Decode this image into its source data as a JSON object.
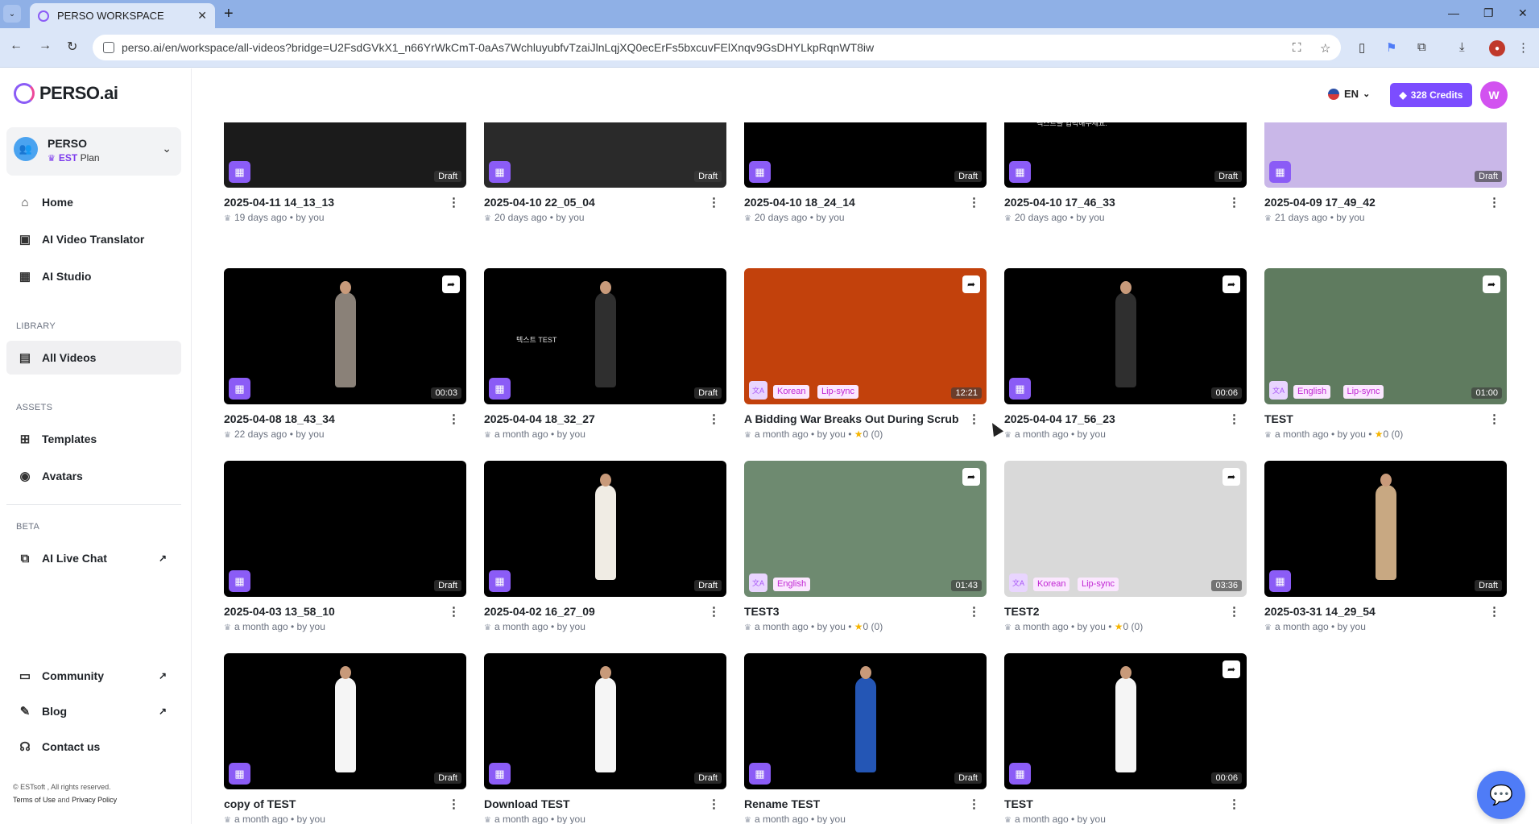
{
  "browser": {
    "tab_title": "PERSO WORKSPACE",
    "url": "perso.ai/en/workspace/all-videos?bridge=U2FsdGVkX1_n66YrWkCmT-0aAs7WchluyubfvTzaiJlnLqjXQ0ecErFs5bxcuvFElXnqv9GsDHYLkpRqnWT8iw",
    "icons": [
      "chevron-down-icon",
      "close-icon",
      "plus-icon",
      "minimize-icon",
      "restore-icon",
      "window-close-icon",
      "back-icon",
      "forward-icon",
      "reload-icon",
      "site-info-icon",
      "translate-icon",
      "star-icon",
      "sidepanel-icon",
      "extension-icon",
      "puzzle-icon",
      "download-icon",
      "profile-icon",
      "more-icon"
    ]
  },
  "sidebar": {
    "logo": "PERSO.ai",
    "workspace": {
      "name": "PERSO",
      "plan_em": "EST",
      "plan": "Plan"
    },
    "main_nav": [
      {
        "label": "Home",
        "icon": "home-icon"
      },
      {
        "label": "AI Video Translator",
        "icon": "translator-icon"
      },
      {
        "label": "AI Studio",
        "icon": "studio-icon"
      }
    ],
    "library_label": "LIBRARY",
    "library": [
      {
        "label": "All Videos",
        "icon": "folder-icon"
      }
    ],
    "assets_label": "ASSETS",
    "assets": [
      {
        "label": "Templates",
        "icon": "template-icon"
      },
      {
        "label": "Avatars",
        "icon": "avatar-icon"
      }
    ],
    "beta_label": "BETA",
    "beta": [
      {
        "label": "AI Live Chat",
        "icon": "chat-icon"
      }
    ],
    "bottom": [
      {
        "label": "Community",
        "icon": "community-icon"
      },
      {
        "label": "Blog",
        "icon": "blog-icon"
      },
      {
        "label": "Contact us",
        "icon": "headset-icon"
      }
    ],
    "footer": {
      "copyright": "© ESTsoft , All rights reserved.",
      "terms": "Terms of Use",
      "and": "and",
      "privacy": "Privacy Policy"
    }
  },
  "header": {
    "lang": "EN",
    "credits": "328 Credits",
    "user_initial": "W"
  },
  "videos": [
    {
      "title": "2025-04-11 14_13_13",
      "meta": "19 days ago • by you",
      "status": "Draft",
      "kind": "studio",
      "bg": "#1b1b1b"
    },
    {
      "title": "2025-04-10 22_05_04",
      "meta": "20 days ago • by you",
      "status": "Draft",
      "kind": "studio",
      "bg": "#2a2a2a"
    },
    {
      "title": "2025-04-10 18_24_14",
      "meta": "20 days ago • by you",
      "status": "Draft",
      "kind": "studio",
      "bg": "#000000"
    },
    {
      "title": "2025-04-10 17_46_33",
      "meta": "20 days ago • by you",
      "status": "Draft",
      "kind": "studio",
      "bg": "#000000",
      "thumb_text": "텍스트를 입력해주세요."
    },
    {
      "title": "2025-04-09 17_49_42",
      "meta": "21 days ago • by you",
      "status": "Draft",
      "kind": "studio",
      "bg": "#c9b7e8"
    },
    {
      "title": "2025-04-08 18_43_34",
      "meta": "22 days ago • by you",
      "status": "00:03",
      "kind": "studio",
      "share": true,
      "bg": "#000000",
      "figure": "#8a8178"
    },
    {
      "title": "2025-04-04 18_32_27",
      "meta": "a month ago • by you",
      "status": "Draft",
      "kind": "studio",
      "bg": "#000000",
      "figure": "#2f2f2f",
      "thumb_text": "텍스트 TEST"
    },
    {
      "title": "A Bidding War Breaks Out During Scrub ...",
      "meta": "a month ago • by you •",
      "rating": "0 (0)",
      "status": "12:21",
      "kind": "translate",
      "tags": [
        "Korean",
        "Lip-sync"
      ],
      "share": true,
      "bg": "#c2410c"
    },
    {
      "title": "2025-04-04 17_56_23",
      "meta": "a month ago • by you",
      "status": "00:06",
      "kind": "studio",
      "share": true,
      "bg": "#000000",
      "figure": "#2f2f2f"
    },
    {
      "title": "TEST",
      "meta": "a month ago • by you •",
      "rating": "0 (0)",
      "status": "01:00",
      "kind": "translate",
      "tags": [
        "English",
        "Lip-sync"
      ],
      "share": true,
      "bg": "#5f7b5f"
    },
    {
      "title": "2025-04-03 13_58_10",
      "meta": "a month ago • by you",
      "status": "Draft",
      "kind": "studio",
      "bg": "#000000"
    },
    {
      "title": "2025-04-02 16_27_09",
      "meta": "a month ago • by you",
      "status": "Draft",
      "kind": "studio",
      "bg": "#000000",
      "figure": "#f0ece4"
    },
    {
      "title": "TEST3",
      "meta": "a month ago • by you •",
      "rating": "0 (0)",
      "status": "01:43",
      "kind": "translate",
      "tags": [
        "English"
      ],
      "share": true,
      "bg": "#6e8a70"
    },
    {
      "title": "TEST2",
      "meta": "a month ago • by you •",
      "rating": "0 (0)",
      "status": "03:36",
      "kind": "translate",
      "tags": [
        "Korean",
        "Lip-sync"
      ],
      "share": true,
      "bg": "#d9d9d9"
    },
    {
      "title": "2025-03-31 14_29_54",
      "meta": "a month ago • by you",
      "status": "Draft",
      "kind": "studio",
      "bg": "#000000",
      "figure": "#c8a882"
    },
    {
      "title": "copy of TEST",
      "meta": "a month ago • by you",
      "status": "Draft",
      "kind": "studio",
      "bg": "#000000",
      "figure": "#f5f5f5"
    },
    {
      "title": "Download TEST",
      "meta": "a month ago • by you",
      "status": "Draft",
      "kind": "studio",
      "bg": "#000000",
      "figure": "#f5f5f5"
    },
    {
      "title": "Rename TEST",
      "meta": "a month ago • by you",
      "status": "Draft",
      "kind": "studio",
      "bg": "#000000",
      "figure": "#2456b5"
    },
    {
      "title": "TEST",
      "meta": "a month ago • by you",
      "status": "00:06",
      "kind": "studio",
      "share": true,
      "bg": "#000000",
      "figure": "#f5f5f5"
    }
  ],
  "colors": {
    "accent": "#7c4dff",
    "studio_badge": "#8b5cf6",
    "tag_text": "#c026d3",
    "star": "#f5b400"
  }
}
